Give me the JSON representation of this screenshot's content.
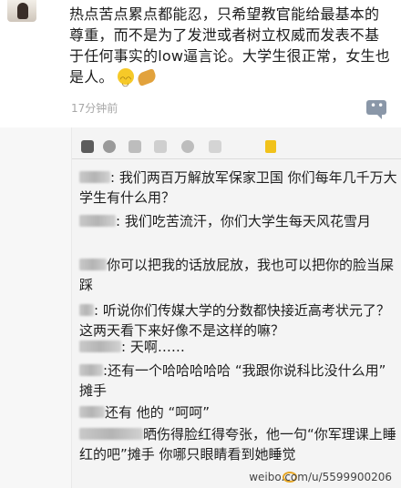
{
  "post": {
    "text": "热点苦点累点都能忍，只希望教官能给最基本的尊重，而不是为了发泄或者树立权威而发表不基于任何事实的low逼言论。大学生很正常，女生也是人。",
    "emoji": "smile-emoji",
    "handshake_icon": "handshake-emoji",
    "timestamp": "17分钟前"
  },
  "chat": {
    "messages": [
      {
        "text": ": 我们两百万解放军保家卫国 你们每年几千万大学生有什么用？"
      },
      {
        "text": ": 我们吃苦流汗，你们大学生每天风花雪月"
      },
      {
        "text": "你可以把我的话放屁放，我也可以把你的脸当屎踩"
      },
      {
        "text": ": 听说你们传媒大学的分数都快接近高考状元了？这两天看下来好像不是这样的嘛？"
      },
      {
        "text": ": 天啊……"
      },
      {
        "text": ":还有一个哈哈哈哈哈 “我跟你说科比没什么用” 摊手"
      },
      {
        "text": "还有 他的 “呵呵”"
      },
      {
        "text": "晒伤得脸红得夸张，他一句“你军理课上睡红的吧”摊手 你哪只眼睛看到她睡觉"
      }
    ]
  },
  "footer": {
    "watermark": "weibo.com/u/5599900206"
  },
  "colors": {
    "accent": "#f1c21b",
    "timestamp": "#a7a7a7",
    "comment_icon": "#8a97a8"
  }
}
